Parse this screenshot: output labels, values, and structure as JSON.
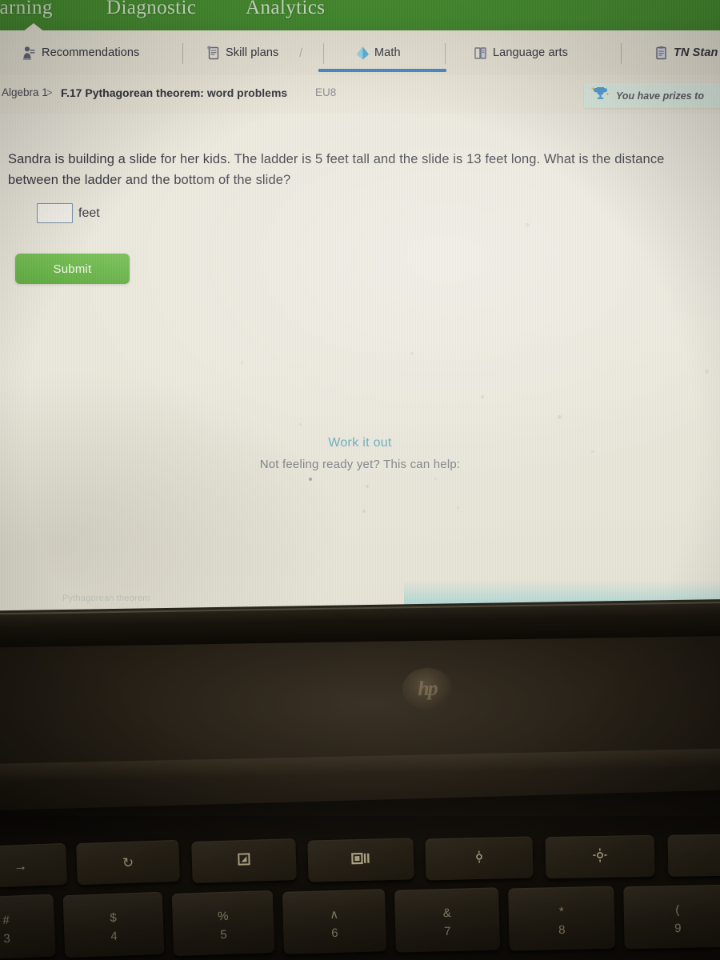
{
  "topnav": {
    "items": [
      {
        "label": "earning",
        "name": "topnav-learning"
      },
      {
        "label": "Diagnostic",
        "name": "topnav-diagnostic"
      },
      {
        "label": "Analytics",
        "name": "topnav-analytics"
      }
    ],
    "background_color": "#3a8a21"
  },
  "tabs": [
    {
      "label": "Recommendations",
      "icon": "recommendations-icon",
      "active": false
    },
    {
      "label": "Skill plans",
      "icon": "skill-plans-icon",
      "active": false
    },
    {
      "label": "Math",
      "icon": "math-diamond-icon",
      "active": true
    },
    {
      "label": "Language arts",
      "icon": "book-icon",
      "active": false
    },
    {
      "label": "TN Stan",
      "icon": "clipboard-icon",
      "active": false
    }
  ],
  "tab_separator_slash": "/",
  "active_tab_color": "#2f7cc2",
  "breadcrumb": {
    "course": "Algebra 1",
    "separator": ">",
    "skill": "F.17 Pythagorean theorem: word problems",
    "code": "EU8"
  },
  "prizes_banner": {
    "text": "You have prizes to",
    "icon": "trophy-icon",
    "background_color": "#d8ebdd"
  },
  "question": {
    "text": "Sandra is building a slide for her kids. The ladder is 5 feet tall and the slide is 13 feet long. What is the distance between the ladder and the bottom of the slide?",
    "answer_value": "",
    "answer_placeholder": "",
    "unit_label": "feet",
    "submit_label": "Submit",
    "submit_color": "#5cb038"
  },
  "work_it_out": {
    "title": "Work it out",
    "subtitle": "Not feeling ready yet? This can help:",
    "title_color": "#4fa3b8",
    "faint_link": "Pythagorean theorem"
  },
  "laptop": {
    "brand": "hp",
    "keyboard": {
      "function_row": [
        "→",
        "↻",
        "window-restore-icon",
        "window-split-icon",
        "brightness-low-icon",
        "brightness-high-icon",
        ""
      ],
      "number_row": [
        "#",
        "$",
        "%",
        "∧",
        "&",
        "*",
        "("
      ],
      "number_row_secondary": [
        "3",
        "4",
        "5",
        "6",
        "7",
        "8",
        "9"
      ]
    }
  }
}
